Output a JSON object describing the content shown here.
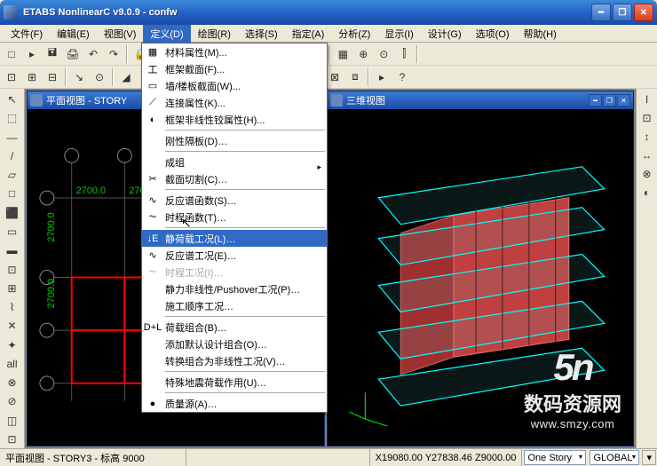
{
  "window": {
    "title": "ETABS NonlinearC v9.0.9 - confw"
  },
  "menubar": {
    "items": [
      {
        "label": "文件(F)"
      },
      {
        "label": "编辑(E)"
      },
      {
        "label": "视图(V)"
      },
      {
        "label": "定义(D)"
      },
      {
        "label": "绘图(R)"
      },
      {
        "label": "选择(S)"
      },
      {
        "label": "指定(A)"
      },
      {
        "label": "分析(Z)"
      },
      {
        "label": "显示(I)"
      },
      {
        "label": "设计(G)"
      },
      {
        "label": "选项(O)"
      },
      {
        "label": "帮助(H)"
      }
    ]
  },
  "dropdown": {
    "items": [
      {
        "label": "材料属性(M)...",
        "icon": "▦"
      },
      {
        "label": "框架截面(F)...",
        "icon": "工"
      },
      {
        "label": "墙/楼板截面(W)...",
        "icon": "▭"
      },
      {
        "label": "连接属性(K)...",
        "icon": "⟋"
      },
      {
        "label": "框架非线性铰属性(H)...",
        "icon": "◐"
      },
      {
        "sep": true
      },
      {
        "label": "刚性隔板(D)…",
        "icon": " "
      },
      {
        "sep": true
      },
      {
        "label": "成组",
        "icon": " ",
        "submenu": true
      },
      {
        "label": "截面切割(C)…",
        "icon": "✂"
      },
      {
        "sep": true
      },
      {
        "label": "反应谱函数(S)…",
        "icon": "∿"
      },
      {
        "label": "时程函数(T)…",
        "icon": "⏦"
      },
      {
        "sep": true
      },
      {
        "label": "静荷载工况(L)…",
        "icon": "↓E",
        "highlight": true
      },
      {
        "label": "反应谱工况(E)…",
        "icon": "∿"
      },
      {
        "label": "时程工况(I)…",
        "icon": "⏦",
        "disabled": true
      },
      {
        "label": "静力非线性/Pushover工况(P)…",
        "icon": " "
      },
      {
        "label": "施工顺序工况…",
        "icon": " "
      },
      {
        "sep": true
      },
      {
        "label": "荷载组合(B)…",
        "icon": "D+L"
      },
      {
        "label": "添加默认设计组合(O)…",
        "icon": " "
      },
      {
        "label": "转换组合为非线性工况(V)…",
        "icon": " "
      },
      {
        "sep": true
      },
      {
        "label": "特殊地震荷载作用(U)…",
        "icon": " "
      },
      {
        "sep": true
      },
      {
        "label": "质量源(A)…",
        "icon": "●"
      }
    ]
  },
  "toolbar": {
    "row1": [
      "□",
      "▸",
      "🖬",
      "🖨",
      "↶",
      "↷",
      "|",
      "🔒",
      "↻",
      "|",
      "🔍",
      "🔎",
      "⬜",
      "📐",
      "|",
      "3d 视",
      "🗗",
      "|",
      "▦",
      "⊕",
      "⊙",
      "⫿",
      "|"
    ],
    "row2": [
      "⊡",
      "▾",
      "⊞",
      "▾",
      "⊟",
      "▾",
      "|",
      "↘",
      "⊙",
      "|",
      "◢",
      "⧉",
      "|",
      "▬",
      "▾",
      "|",
      "⊡",
      "▾",
      "|",
      "⊗",
      "▾",
      "|",
      "⬚",
      "⊞",
      "⊟",
      "⊡",
      "⊠",
      "⧈",
      "|",
      "▸",
      "?"
    ]
  },
  "left_tools": [
    "↖",
    "⬚",
    "—",
    "/",
    "▱",
    "□",
    "⬛",
    "▭",
    "▬",
    "⊡",
    "⊞",
    "⌇",
    "✕",
    "✦",
    "all",
    "⊗",
    "⊘",
    "◫",
    "⊡"
  ],
  "right_tools": [
    "I",
    "⊡",
    "↕",
    "↔",
    "⊗",
    "◐"
  ],
  "child_windows": {
    "plan": {
      "title": "平面视图 - STORY"
    },
    "view3d": {
      "title": "三维视图"
    }
  },
  "statusbar": {
    "left": "平面视图 - STORY3 - 标高 9000",
    "coords": "X19080.00  Y27838.46  Z9000.00",
    "story_combo": "One Story",
    "units_combo": "GLOBAL",
    "end": "▾"
  },
  "watermark": {
    "logo": "5n",
    "cn": "数码资源网",
    "url": "www.smzy.com"
  }
}
